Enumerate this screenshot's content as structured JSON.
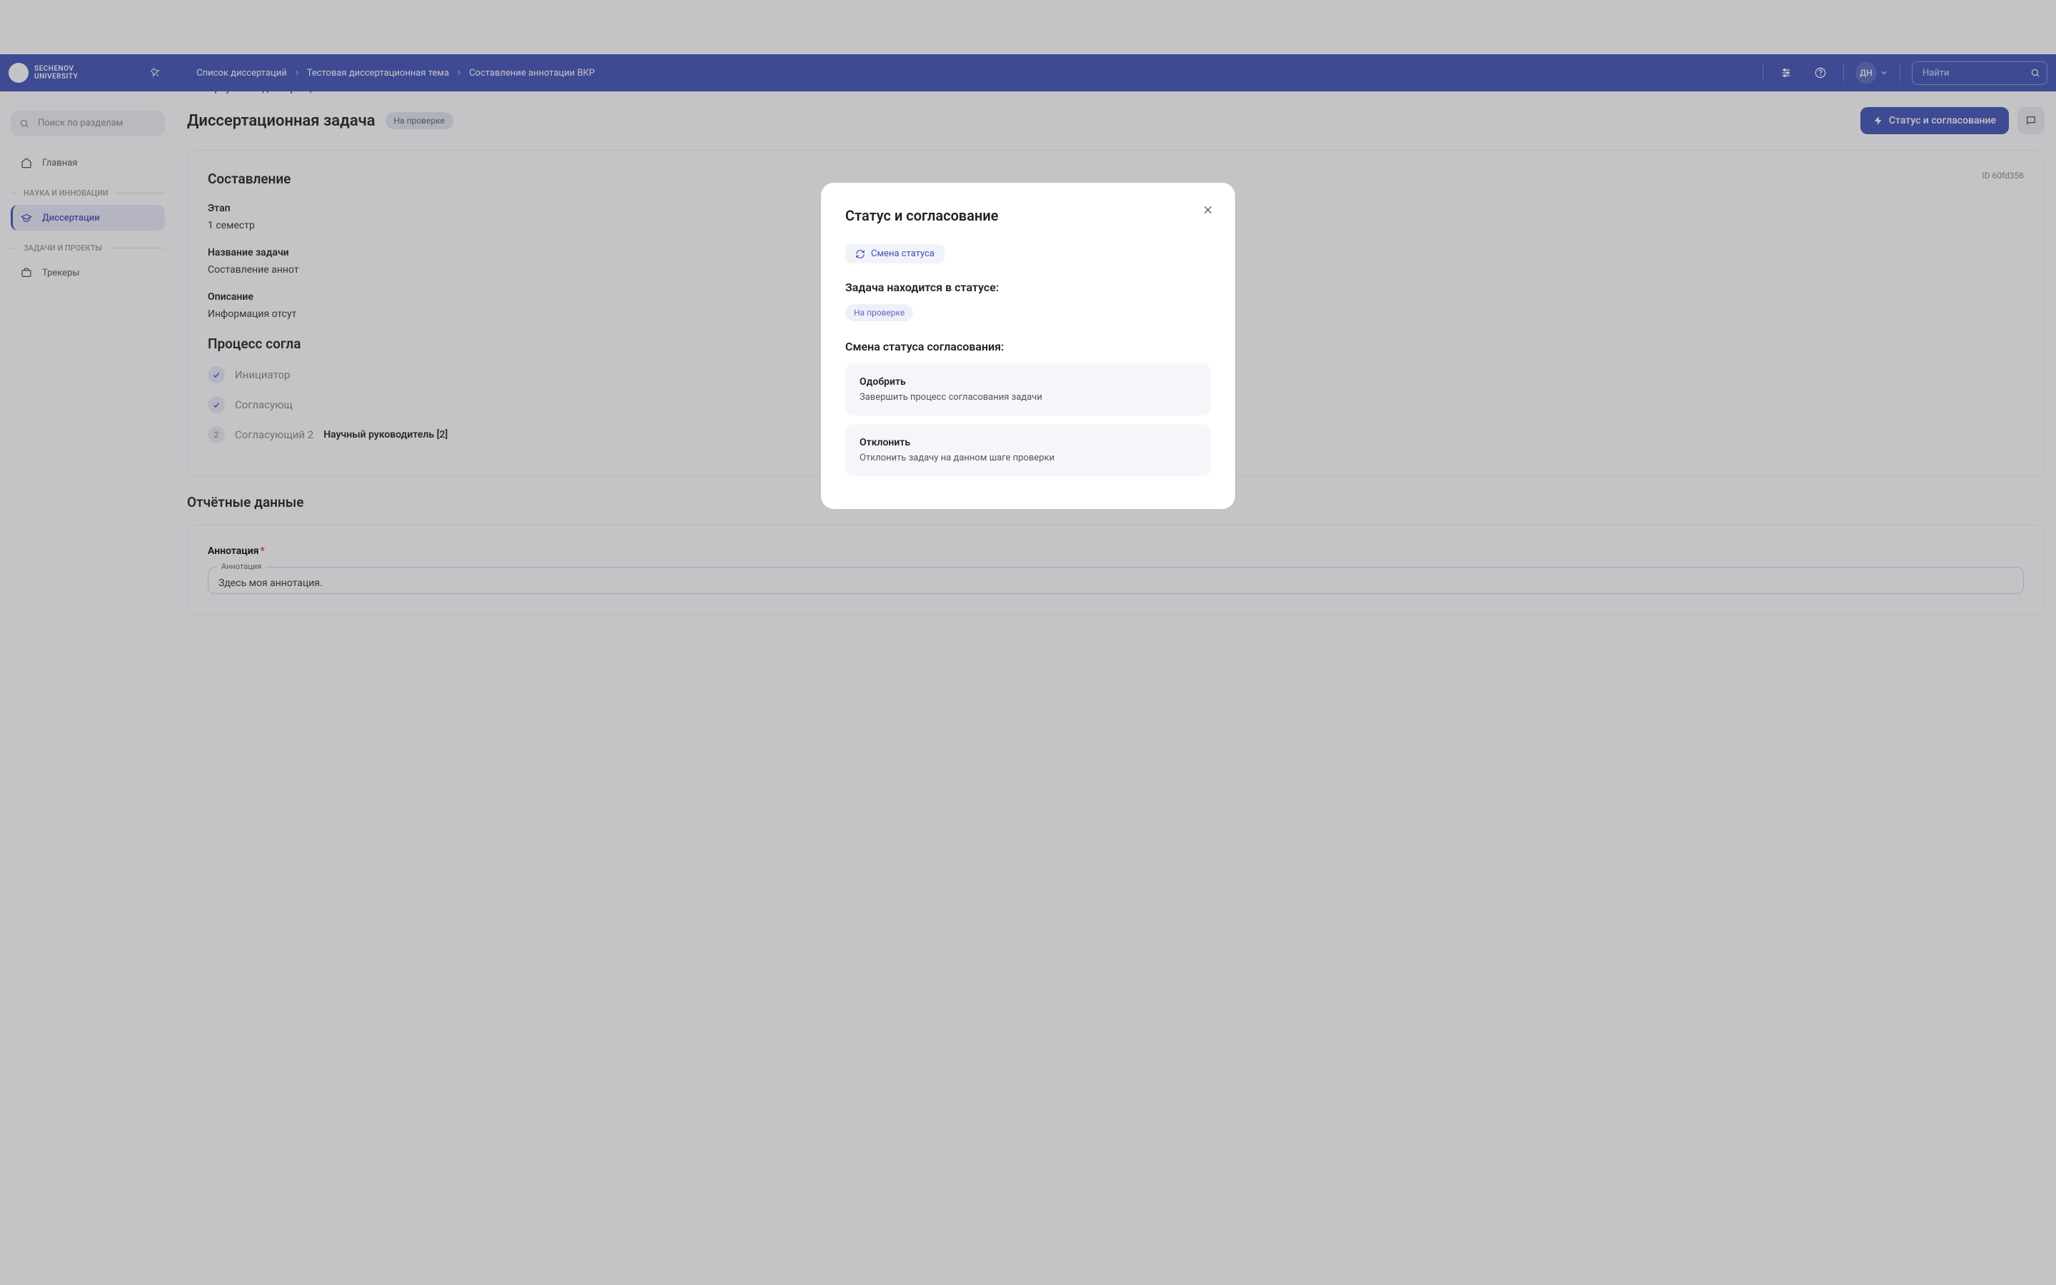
{
  "logo": {
    "line1": "SECHENOV",
    "line2": "UNIVERSITY"
  },
  "breadcrumb": [
    "Список диссертаций",
    "Тестовая диссертационная тема",
    "Составление аннотации ВКР"
  ],
  "topbar": {
    "avatar_initials": "ДН",
    "search_placeholder": "Найти"
  },
  "sidebar": {
    "search_placeholder": "Поиск по разделам",
    "home": "Главная",
    "section1": "НАУКА И ИННОВАЦИИ",
    "dissertations": "Диссертации",
    "section2": "ЗАДАЧИ И ПРОЕКТЫ",
    "trackers": "Трекеры"
  },
  "page": {
    "back": "Вернуться к диссертации",
    "title": "Диссертационная задача",
    "status": "На проверке",
    "status_btn": "Статус и согласование"
  },
  "card": {
    "title": "Составление",
    "id": "ID 60fd356",
    "stage_label": "Этап",
    "stage_value": "1 семестр",
    "name_label": "Название задачи",
    "name_value": "Составление аннот",
    "desc_label": "Описание",
    "desc_value": "Информация отсут",
    "process_title": "Процесс согла",
    "steps": [
      {
        "label": "Инициатор",
        "value": "",
        "done": true,
        "num": ""
      },
      {
        "label": "Согласующ",
        "value": "",
        "done": true,
        "num": ""
      },
      {
        "label": "Согласующий 2",
        "value": "Научный руководитель [2]",
        "done": false,
        "num": "2"
      }
    ]
  },
  "report": {
    "title": "Отчётные данные",
    "annotation_label": "Аннотация",
    "annotation_legend": "Аннотация",
    "annotation_value": "Здесь моя аннотация."
  },
  "modal": {
    "title": "Статус и согласование",
    "change_btn": "Смена статуса",
    "status_label": "Задача находится в статусе:",
    "status_value": "На проверке",
    "approval_label": "Смена статуса согласования:",
    "actions": [
      {
        "title": "Одобрить",
        "desc": "Завершить процесс согласования задачи"
      },
      {
        "title": "Отклонить",
        "desc": "Отклонить задачу на данном шаге проверки"
      }
    ]
  }
}
